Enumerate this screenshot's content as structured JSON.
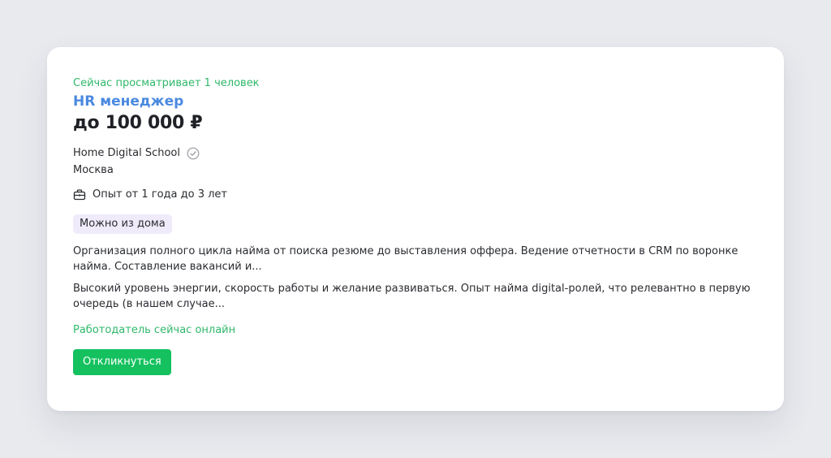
{
  "vacancy": {
    "viewers_text": "Сейчас просматривает 1 человек",
    "title": "HR менеджер",
    "salary": "до 100 000 ₽",
    "company": "Home Digital School",
    "company_verified_icon": "check-circle-icon",
    "city": "Москва",
    "experience_icon": "briefcase-icon",
    "experience": "Опыт от 1 года до 3 лет",
    "tag": "Можно из дома",
    "description_1": "Организация полного цикла найма от поиска резюме до выставления оффера. Ведение отчетности в CRM по воронке найма. Составление вакансий и...",
    "description_2": "Высокий уровень энергии, скорость работы и желание развиваться. Опыт найма digital-ролей, что релевантно в первую очередь (в нашем случае...",
    "employer_status": "Работодатель сейчас онлайн",
    "respond_label": "Откликнуться"
  },
  "colors": {
    "page_background": "#e9eaee",
    "card_background": "#ffffff",
    "title_link": "#4a8ae0",
    "online_green": "#2fb86a",
    "button_green": "#14c15e",
    "tag_background": "#efebfb",
    "text": "#2a2c31"
  }
}
